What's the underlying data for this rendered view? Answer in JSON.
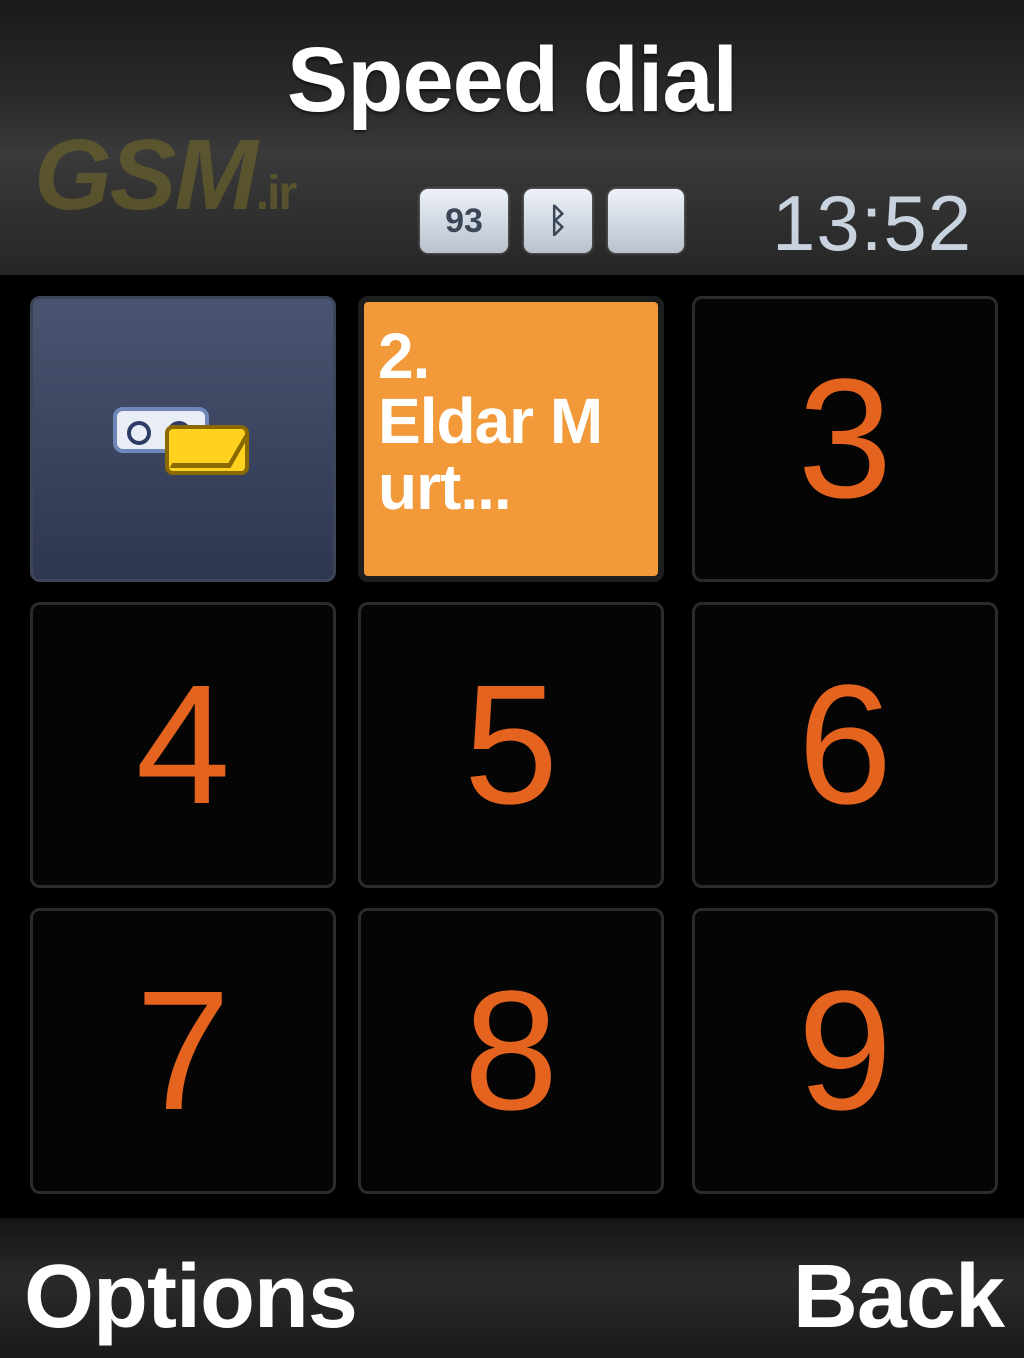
{
  "screen": {
    "title": "Speed dial",
    "watermark": "GSM",
    "watermark_suffix": ".ir",
    "clock": "13:52"
  },
  "status_icons": [
    {
      "name": "network-icon",
      "label": "93"
    },
    {
      "name": "bluetooth-icon",
      "label": "ᛒ"
    },
    {
      "name": "memory-card-icon",
      "label": ""
    }
  ],
  "grid": {
    "slot1": {
      "icon": "voicemail-icon"
    },
    "slot2": {
      "label": "2.\nEldar M\nurt..."
    },
    "slot3": {
      "label": "3"
    },
    "slot4": {
      "label": "4"
    },
    "slot5": {
      "label": "5"
    },
    "slot6": {
      "label": "6"
    },
    "slot7": {
      "label": "7"
    },
    "slot8": {
      "label": "8"
    },
    "slot9": {
      "label": "9"
    }
  },
  "softkeys": {
    "left": "Options",
    "right": "Back"
  },
  "colors": {
    "accent": "#f29a3a",
    "digit": "#e3631f",
    "voicemail_bg": "#3a4360"
  }
}
